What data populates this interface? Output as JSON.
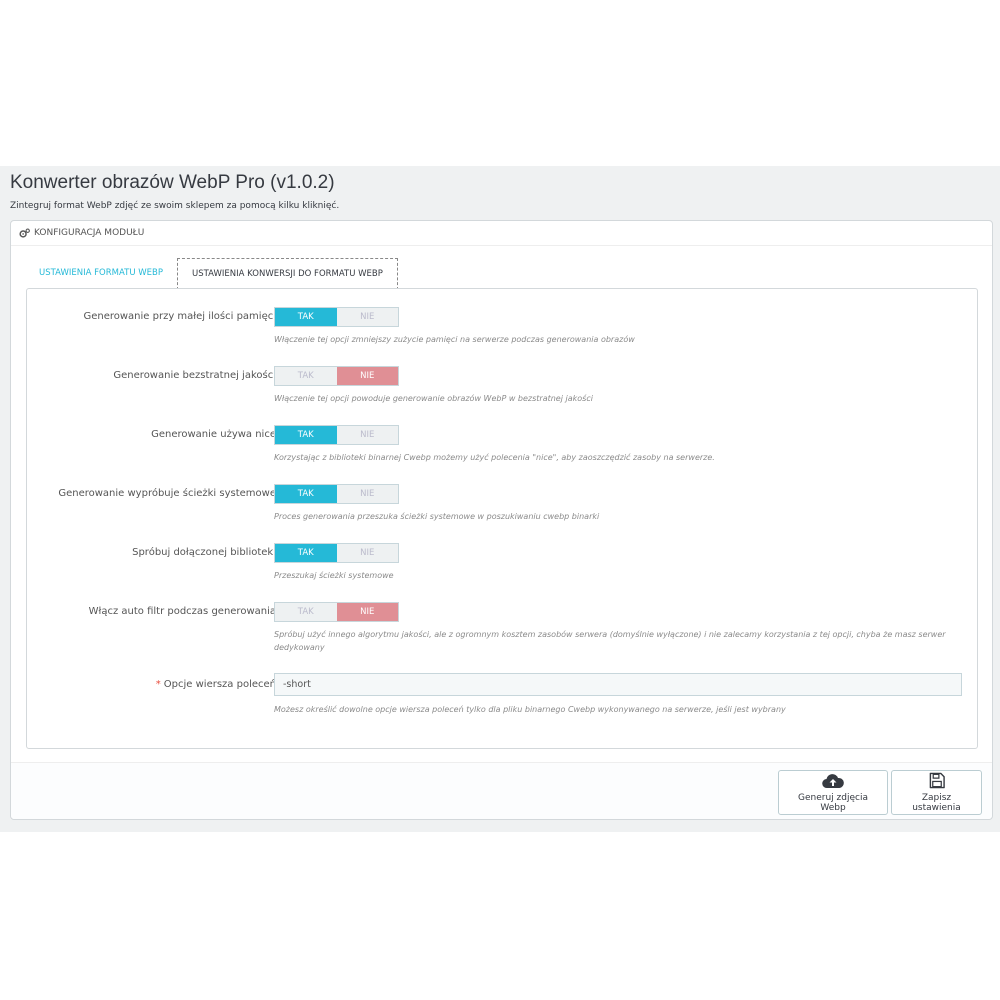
{
  "header": {
    "title": "Konwerter obrazów WebP Pro (v1.0.2)",
    "subtitle": "Zintegruj format WebP zdjęć ze swoim sklepem za pomocą kilku kliknięć."
  },
  "panel": {
    "heading": "KONFIGURACJA MODUŁU",
    "heading_icon": "cogs-icon"
  },
  "tabs": [
    {
      "label": "USTAWIENIA FORMATU WEBP"
    },
    {
      "label": "USTAWIENIA KONWERSJI DO FORMATU WEBP"
    }
  ],
  "switch_labels": {
    "yes": "TAK",
    "no": "NIE"
  },
  "settings": [
    {
      "label": "Generowanie przy małej ilości pamięci",
      "value": "TAK",
      "help": "Włączenie tej opcji zmniejszy zużycie pamięci na serwerze podczas generowania obrazów"
    },
    {
      "label": "Generowanie bezstratnej jakości",
      "value": "NIE",
      "help": "Włączenie tej opcji powoduje generowanie obrazów WebP w bezstratnej jakości"
    },
    {
      "label": "Generowanie używa nice",
      "value": "TAK",
      "help": "Korzystając z biblioteki binarnej Cwebp możemy użyć polecenia \"nice\", aby zaoszczędzić zasoby na serwerze."
    },
    {
      "label": "Generowanie wypróbuje ścieżki systemowe",
      "value": "TAK",
      "help": "Proces generowania przeszuka ścieżki systemowe w poszukiwaniu cwebp binarki"
    },
    {
      "label": "Spróbuj dołączonej biblioteki",
      "value": "TAK",
      "help": "Przeszukaj ścieżki systemowe"
    },
    {
      "label": "Włącz auto filtr podczas generowania",
      "value": "NIE",
      "help": "Spróbuj użyć innego algorytmu jakości, ale z ogromnym kosztem zasobów serwera (domyślnie wyłączone) i nie zalecamy korzystania z tej opcji, chyba że masz serwer dedykowany"
    }
  ],
  "command_line": {
    "required_mark": "*",
    "label": "Opcje wiersza poleceń",
    "value": "-short",
    "help": "Możesz określić dowolne opcje wiersza poleceń tylko dla pliku binarnego Cwebp wykonywanego na serwerze, jeśli jest wybrany"
  },
  "footer": {
    "generate_label": "Generuj zdjęcia Webp",
    "generate_icon": "cloud-upload-icon",
    "save_label": "Zapisz ustawienia",
    "save_icon": "floppy-disk-icon"
  },
  "colors": {
    "accent": "#25b9d7",
    "no_active": "#e08f95",
    "background": "#eff1f2"
  }
}
